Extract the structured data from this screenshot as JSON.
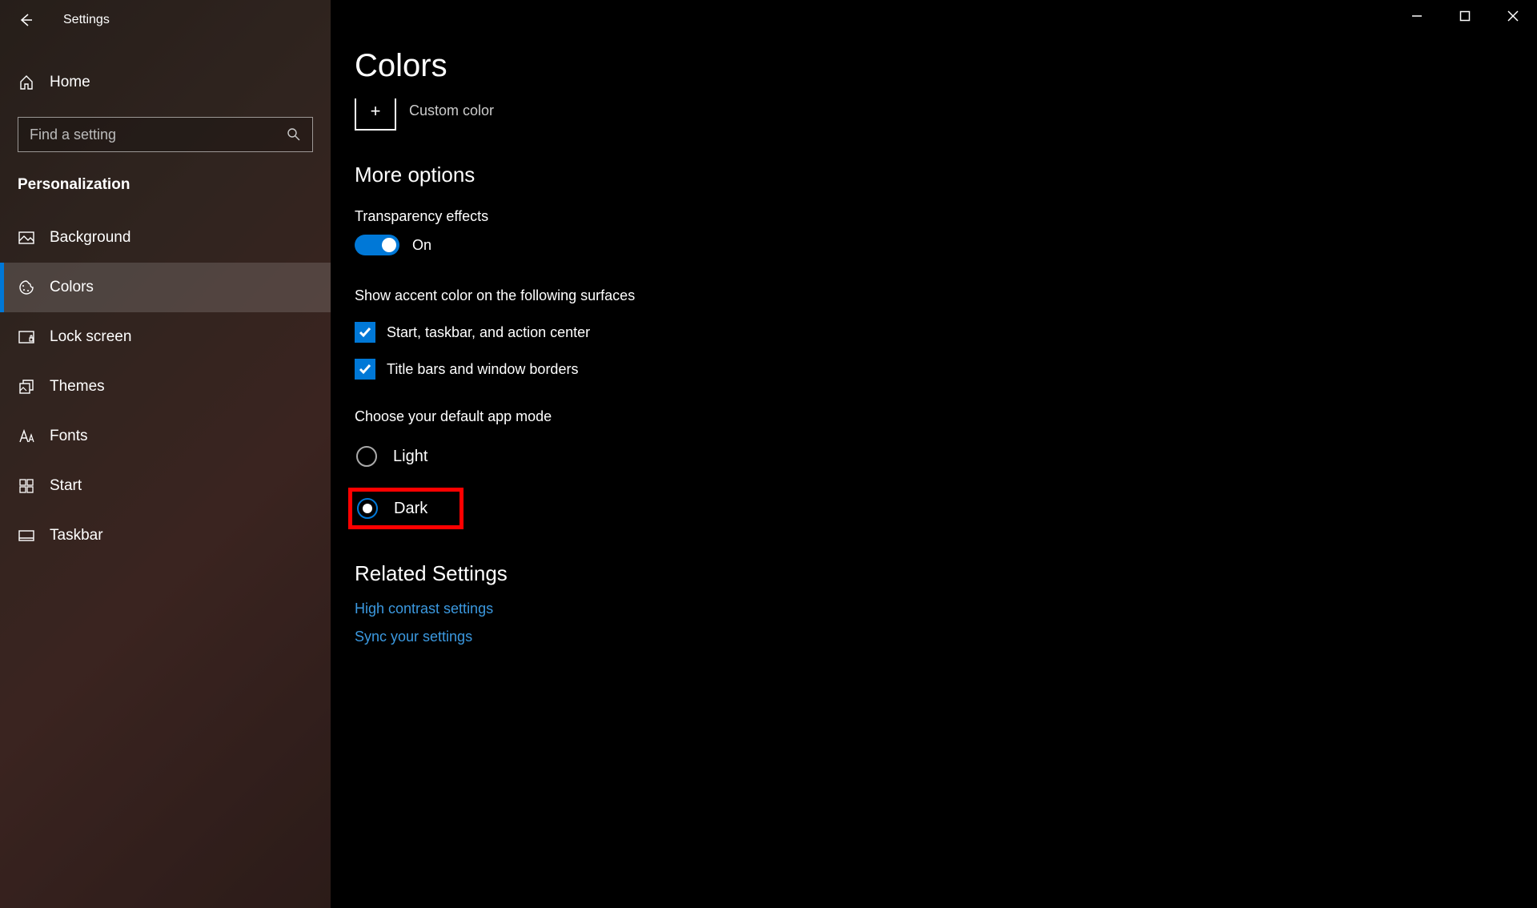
{
  "window": {
    "title": "Settings"
  },
  "sidebar": {
    "home": "Home",
    "search_placeholder": "Find a setting",
    "category": "Personalization",
    "items": [
      {
        "label": "Background",
        "active": false
      },
      {
        "label": "Colors",
        "active": true
      },
      {
        "label": "Lock screen",
        "active": false
      },
      {
        "label": "Themes",
        "active": false
      },
      {
        "label": "Fonts",
        "active": false
      },
      {
        "label": "Start",
        "active": false
      },
      {
        "label": "Taskbar",
        "active": false
      }
    ]
  },
  "main": {
    "title": "Colors",
    "custom_color": "Custom color",
    "more_options": "More options",
    "transparency": {
      "label": "Transparency effects",
      "state": "On"
    },
    "accent": {
      "heading": "Show accent color on the following surfaces",
      "cb1": "Start, taskbar, and action center",
      "cb2": "Title bars and window borders"
    },
    "app_mode": {
      "heading": "Choose your default app mode",
      "light": "Light",
      "dark": "Dark"
    },
    "related": {
      "heading": "Related Settings",
      "link1": "High contrast settings",
      "link2": "Sync your settings"
    }
  }
}
